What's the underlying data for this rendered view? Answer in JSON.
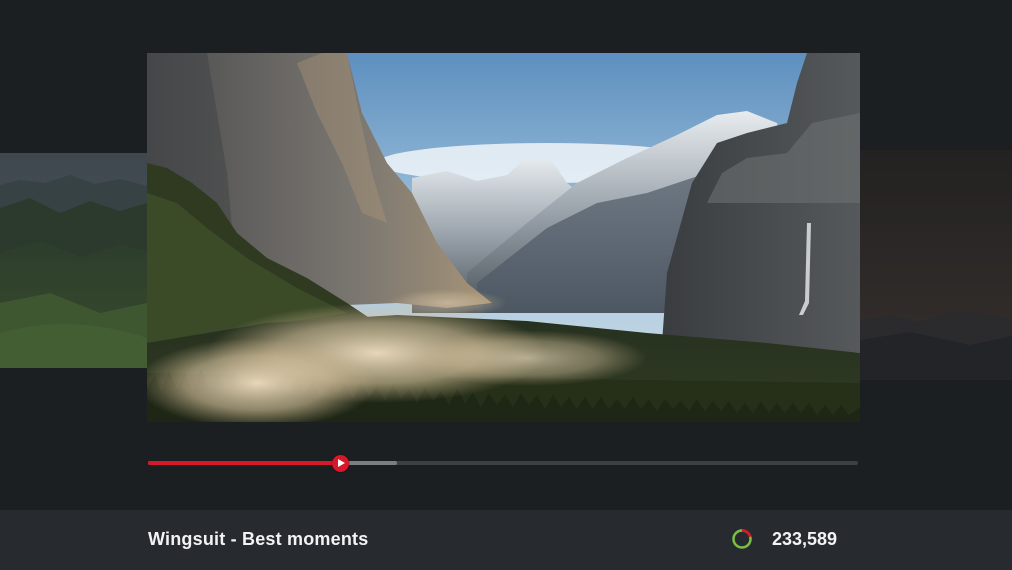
{
  "video": {
    "title": "Wingsuit - Best moments",
    "view_count": "233,589",
    "progress_played": 0.27,
    "progress_buffered": 0.35
  },
  "colors": {
    "background": "#1c1f22",
    "info_bar": "#272b2f",
    "accent_red": "#d7172a",
    "views_ring_green": "#7cc043",
    "views_ring_red": "#d7172a"
  },
  "icons": {
    "play_knob": "play-icon",
    "views": "views-ring-icon"
  }
}
